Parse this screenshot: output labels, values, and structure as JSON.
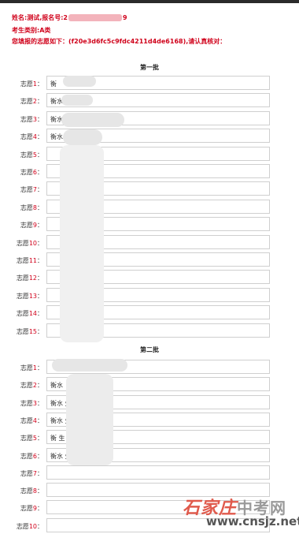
{
  "header": {
    "name_line_prefix": "姓名:测试,报名号:2",
    "name_line_suffix": "9",
    "category_line": "考生类别:A类",
    "notice_line": "您填报的志愿如下：(f20e3d6fc5c9fdc4211d4de6168),请认真核对："
  },
  "label_prefix": "志愿",
  "label_suffix": "：",
  "batch1": {
    "title": "第一批",
    "items": [
      {
        "num": "1",
        "value": "衡"
      },
      {
        "num": "2",
        "value": "衡水"
      },
      {
        "num": "3",
        "value": "衡水"
      },
      {
        "num": "4",
        "value": "衡水"
      },
      {
        "num": "5",
        "value": ""
      },
      {
        "num": "6",
        "value": ""
      },
      {
        "num": "7",
        "value": ""
      },
      {
        "num": "8",
        "value": ""
      },
      {
        "num": "9",
        "value": ""
      },
      {
        "num": "10",
        "value": ""
      },
      {
        "num": "11",
        "value": ""
      },
      {
        "num": "12",
        "value": ""
      },
      {
        "num": "13",
        "value": ""
      },
      {
        "num": "14",
        "value": ""
      },
      {
        "num": "15",
        "value": ""
      }
    ]
  },
  "batch2": {
    "title": "第二批",
    "items": [
      {
        "num": "1",
        "value": ""
      },
      {
        "num": "2",
        "value": "衡水"
      },
      {
        "num": "3",
        "value": "衡水                生"
      },
      {
        "num": "4",
        "value": "衡水                生"
      },
      {
        "num": "5",
        "value": "衡                  生"
      },
      {
        "num": "6",
        "value": "衡水                生"
      },
      {
        "num": "7",
        "value": ""
      },
      {
        "num": "8",
        "value": ""
      },
      {
        "num": "9",
        "value": ""
      },
      {
        "num": "10",
        "value": ""
      }
    ]
  },
  "watermark": {
    "brand_italic": "石家庄",
    "brand_rest": "中考网",
    "url": "www.cnsjz.net"
  }
}
